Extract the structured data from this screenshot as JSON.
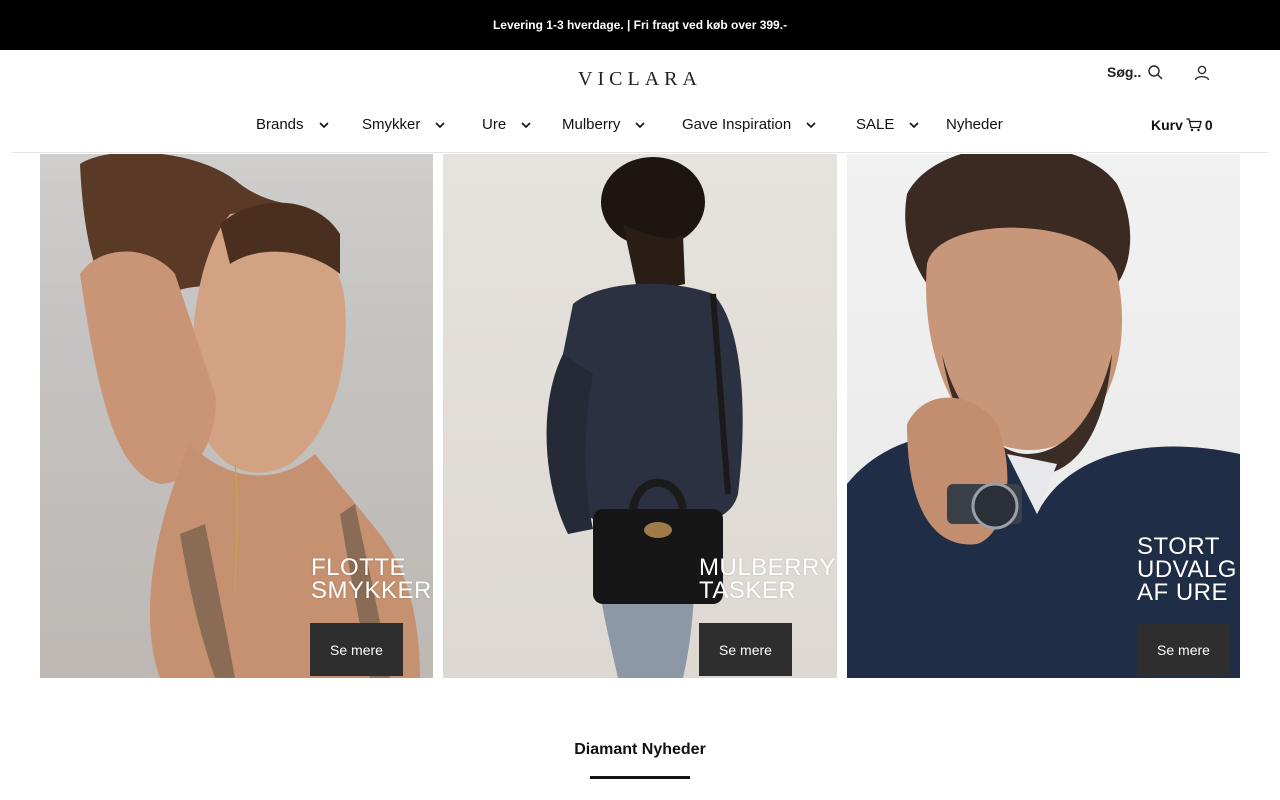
{
  "announcement": "Levering 1-3 hverdage. | Fri fragt ved køb over 399.-",
  "header": {
    "logo": "VICLARA",
    "search_label": "Søg..",
    "cart_label": "Kurv",
    "cart_count": "0"
  },
  "nav": {
    "items": [
      {
        "label": "Brands",
        "has_dropdown": true
      },
      {
        "label": "Smykker",
        "has_dropdown": true
      },
      {
        "label": "Ure",
        "has_dropdown": true
      },
      {
        "label": "Mulberry",
        "has_dropdown": true
      },
      {
        "label": "Gave Inspiration",
        "has_dropdown": true
      },
      {
        "label": "SALE",
        "has_dropdown": true
      },
      {
        "label": "Nyheder",
        "has_dropdown": false
      }
    ]
  },
  "promo_tiles": [
    {
      "heading": "FLOTTE\nSMYKKER",
      "button": "Se mere"
    },
    {
      "heading": "MULBERRY\nTASKER",
      "button": "Se mere"
    },
    {
      "heading": "STORT\nUDVALG\nAF URE",
      "button": "Se mere"
    }
  ],
  "section": {
    "title": "Diamant Nyheder"
  },
  "icons": [
    "search-icon",
    "account-icon",
    "cart-icon",
    "chevron-down-icon"
  ],
  "colors": {
    "announcement_bg": "#000000",
    "button_bg": "#2e2e2e",
    "text": "#111111"
  }
}
